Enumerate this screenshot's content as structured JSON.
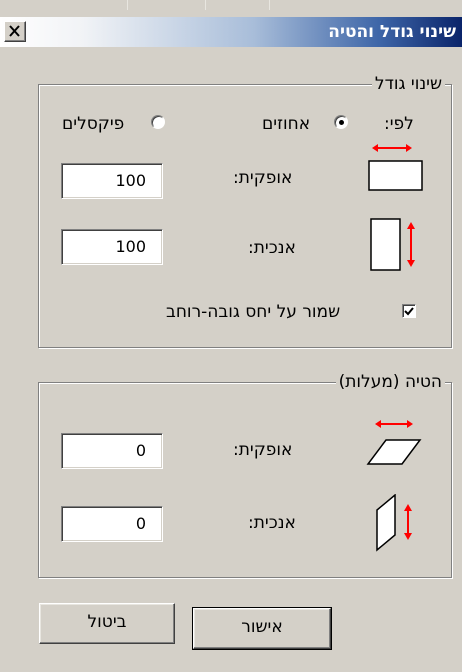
{
  "window": {
    "title": "שינוי גודל והטיה",
    "close_symbol": "✕"
  },
  "resize": {
    "legend": "שינוי גודל",
    "by_label": "לפי:",
    "options": [
      {
        "label": "אחוזים",
        "selected": true
      },
      {
        "label": "פיקסלים",
        "selected": false
      }
    ],
    "horizontal_label": "אופקית:",
    "horizontal_value": "100",
    "vertical_label": "אנכית:",
    "vertical_value": "100",
    "keep_ratio_label": "שמור על יחס גובה-רוחב",
    "keep_ratio_checked": true
  },
  "skew": {
    "legend": "הטיה (מעלות)",
    "horizontal_label": "אופקית:",
    "horizontal_value": "0",
    "vertical_label": "אנכית:",
    "vertical_value": "0"
  },
  "buttons": {
    "ok_label": "אישור",
    "cancel_label": "ביטול"
  },
  "colors": {
    "dialog_bg": "#d4d0c8",
    "title_text": "#ffffff",
    "title_dark": "#0a246a",
    "arrow_red": "#ff0000"
  },
  "icons": [
    "close-icon",
    "horizontal-stretch-icon",
    "vertical-stretch-icon",
    "horizontal-skew-icon",
    "vertical-skew-icon",
    "check-icon"
  ]
}
